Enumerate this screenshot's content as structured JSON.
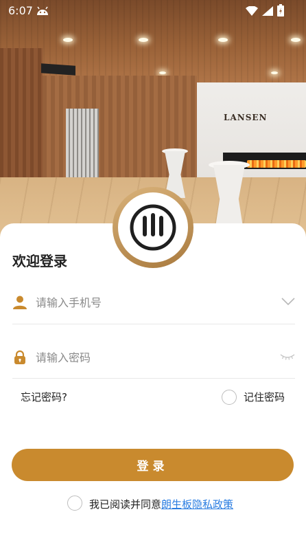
{
  "status_bar": {
    "time": "6:07",
    "icons": [
      "android-debug-icon",
      "wifi-icon",
      "signal-icon",
      "battery-charging-icon"
    ]
  },
  "background": {
    "brand_sign": "LANSEN"
  },
  "login": {
    "title": "欢迎登录",
    "phone": {
      "placeholder": "请输入手机号",
      "value": "",
      "icon": "user-icon"
    },
    "password": {
      "placeholder": "请输入密码",
      "value": "",
      "icon": "lock-icon"
    },
    "forgot_password": "忘记密码?",
    "remember_password": "记住密码",
    "remember_checked": false,
    "submit": "登录",
    "agreement_prefix": "我已阅读并同意",
    "agreement_link": "朗生板隐私政策",
    "agreement_checked": false
  },
  "colors": {
    "accent": "#c98a2e",
    "link": "#2a7de1",
    "icon": "#c98a2e"
  }
}
